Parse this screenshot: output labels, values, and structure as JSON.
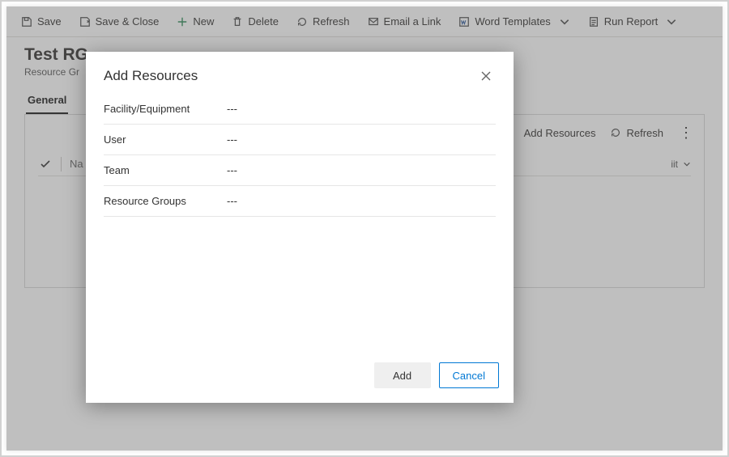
{
  "toolbar": {
    "save": "Save",
    "save_close": "Save & Close",
    "new": "New",
    "delete": "Delete",
    "refresh": "Refresh",
    "email_link": "Email a Link",
    "word_templates": "Word Templates",
    "run_report": "Run Report"
  },
  "page": {
    "title": "Test RG",
    "subtitle": "Resource Gr",
    "tab_general": "General"
  },
  "panel": {
    "add_resources": "Add Resources",
    "refresh": "Refresh",
    "name_header": "Na",
    "unit_text": "iit"
  },
  "modal": {
    "title": "Add Resources",
    "rows": [
      {
        "label": "Facility/Equipment",
        "value": "---"
      },
      {
        "label": "User",
        "value": "---"
      },
      {
        "label": "Team",
        "value": "---"
      },
      {
        "label": "Resource Groups",
        "value": "---"
      }
    ],
    "add": "Add",
    "cancel": "Cancel"
  }
}
